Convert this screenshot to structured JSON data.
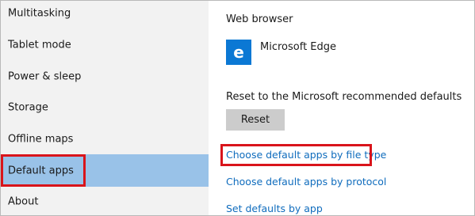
{
  "sidebar": {
    "items": [
      {
        "label": "Multitasking"
      },
      {
        "label": "Tablet mode"
      },
      {
        "label": "Power & sleep"
      },
      {
        "label": "Storage"
      },
      {
        "label": "Offline maps"
      },
      {
        "label": "Default apps",
        "selected": true
      },
      {
        "label": "About"
      }
    ]
  },
  "content": {
    "web_browser_heading": "Web browser",
    "browser_app": {
      "name": "Microsoft Edge",
      "icon": "edge-icon",
      "tile_color": "#0b78d4"
    },
    "reset_description": "Reset to the Microsoft recommended defaults",
    "reset_button": "Reset",
    "links": [
      {
        "label": "Choose default apps by file type",
        "highlighted": true
      },
      {
        "label": "Choose default apps by protocol"
      },
      {
        "label": "Set defaults by app"
      }
    ]
  },
  "colors": {
    "selected_background": "#99c2e8",
    "highlight_border": "#d9141b",
    "link": "#0f6cbd",
    "sidebar_background": "#f2f2f2",
    "button_background": "#cccccc"
  }
}
